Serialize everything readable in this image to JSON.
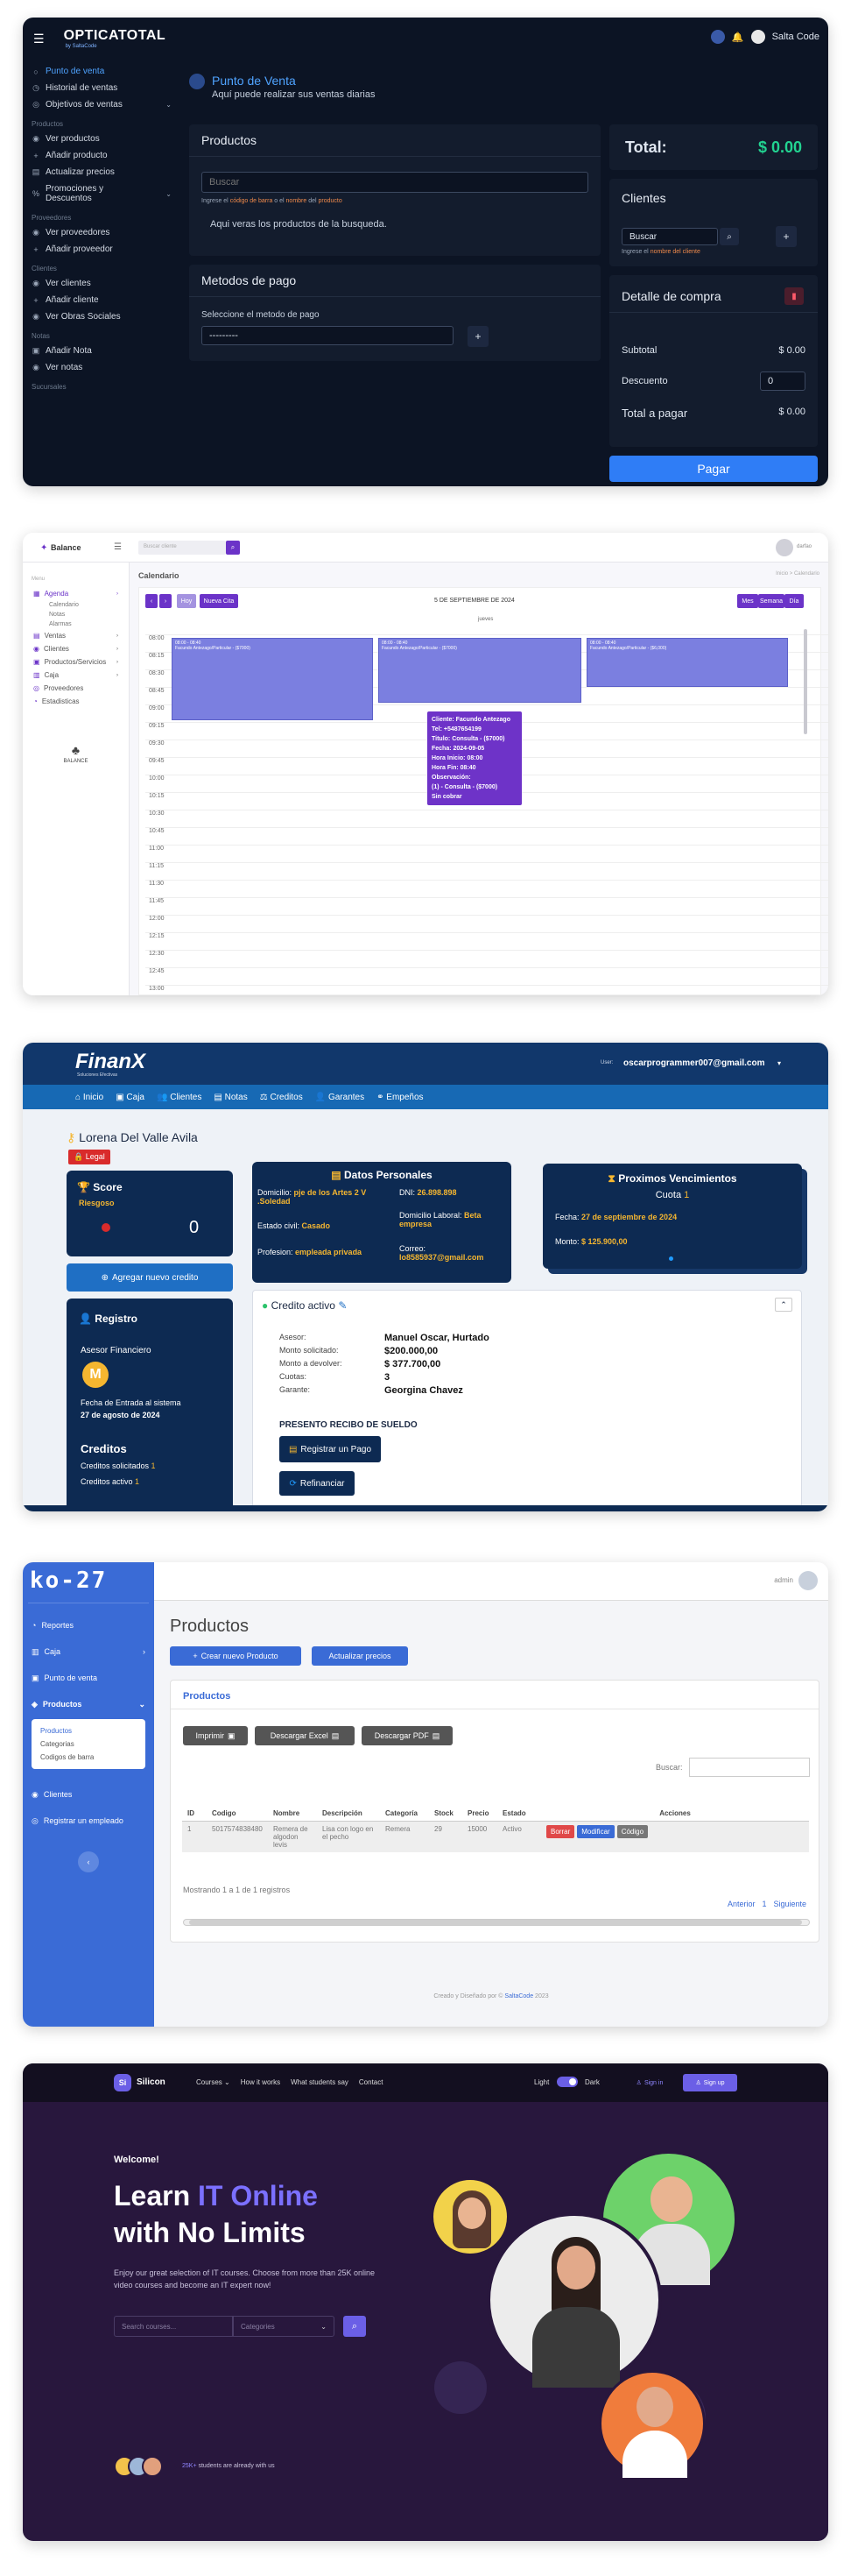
{
  "p1": {
    "brand": "OPTICATOTAL",
    "brand_sub": "by SaltaCode",
    "user": "Salta Code",
    "title": "Punto de Venta",
    "subtitle": "Aquí puede realizar sus ventas diarias",
    "sidebar": [
      {
        "type": "item",
        "label": "Punto de venta",
        "active": true,
        "icon": "○"
      },
      {
        "type": "item",
        "label": "Historial de ventas",
        "icon": "◷"
      },
      {
        "type": "item",
        "label": "Objetivos de ventas",
        "icon": "◎",
        "chev": true
      },
      {
        "type": "sec",
        "label": "Productos"
      },
      {
        "type": "item",
        "label": "Ver productos",
        "icon": "◉"
      },
      {
        "type": "item",
        "label": "Añadir producto",
        "icon": "+"
      },
      {
        "type": "item",
        "label": "Actualizar precios",
        "icon": "▤"
      },
      {
        "type": "item",
        "label": "Promociones y Descuentos",
        "icon": "%",
        "chev": true,
        "tall": true
      },
      {
        "type": "sec",
        "label": "Proveedores"
      },
      {
        "type": "item",
        "label": "Ver proveedores",
        "icon": "◉"
      },
      {
        "type": "item",
        "label": "Añadir proveedor",
        "icon": "+"
      },
      {
        "type": "sec",
        "label": "Clientes"
      },
      {
        "type": "item",
        "label": "Ver clientes",
        "icon": "◉"
      },
      {
        "type": "item",
        "label": "Añadir cliente",
        "icon": "+"
      },
      {
        "type": "item",
        "label": "Ver Obras Sociales",
        "icon": "◉"
      },
      {
        "type": "sec",
        "label": "Notas"
      },
      {
        "type": "item",
        "label": "Añadir Nota",
        "icon": "▣"
      },
      {
        "type": "item",
        "label": "Ver notas",
        "icon": "◉"
      },
      {
        "type": "sec",
        "label": "Sucursales"
      }
    ],
    "productos_title": "Productos",
    "search_placeholder": "Buscar",
    "search_hint_a": "Ingrese el ",
    "search_hint_b": "código de barra",
    "search_hint_c": " o el ",
    "search_hint_d": "nombre",
    "search_hint_e": " del ",
    "search_hint_f": "producto",
    "empty_text": "Aqui veras los productos de la busqueda.",
    "metodos_title": "Metodos de pago",
    "metodos_label": "Seleccione el metodo de pago",
    "metodos_value": "---------",
    "total_label": "Total:",
    "total_value": "$ 0.00",
    "clientes_title": "Clientes",
    "clientes_value": "Buscar",
    "clientes_hint_a": "Ingrese el ",
    "clientes_hint_b": "nombre del cliente",
    "detalle_title": "Detalle de compra",
    "subtotal_label": "Subtotal",
    "subtotal_value": "$ 0.00",
    "descuento_label": "Descuento",
    "descuento_value": "0",
    "pagar_label": "Total a pagar",
    "pagar_value": "$ 0.00",
    "pagar_button": "Pagar"
  },
  "p2": {
    "brand": "Balance",
    "search_placeholder": "Buscar cliente",
    "user": "darfao",
    "menu_label": "Menu",
    "sidebar": [
      {
        "label": "Agenda",
        "icon": "▦",
        "chev": true,
        "active": true
      },
      {
        "label": "Calendario",
        "sub": true
      },
      {
        "label": "Notas",
        "sub": true
      },
      {
        "label": "Alarmas",
        "sub": true
      },
      {
        "label": "Ventas",
        "icon": "▤",
        "chev": true
      },
      {
        "label": "Clientes",
        "icon": "◉",
        "chev": true
      },
      {
        "label": "Productos/Servicios",
        "icon": "▣",
        "chev": true
      },
      {
        "label": "Caja",
        "icon": "▥",
        "chev": true
      },
      {
        "label": "Proveedores",
        "icon": "◎"
      },
      {
        "label": "Estadisticas",
        "icon": "◔"
      }
    ],
    "logo_text": "BALANCE",
    "page_title": "Calendario",
    "breadcrumb": "Inicio  >  Calendario",
    "btn_hoy": "Hoy",
    "btn_nueva": "Nueva Cita",
    "date_title": "5 DE SEPTIEMBRE DE 2024",
    "btn_mes": "Mes",
    "btn_semana": "Semana",
    "btn_dia": "Día",
    "day_header": "jueves",
    "times": [
      "08:00",
      "08:15",
      "08:30",
      "08:45",
      "09:00",
      "09:15",
      "09:30",
      "09:45",
      "10:00",
      "10:15",
      "10:30",
      "10:45",
      "11:00",
      "11:15",
      "11:30",
      "11:45",
      "12:00",
      "12:15",
      "12:30",
      "12:45",
      "13:00"
    ],
    "ev_time": "08:00 - 08:40",
    "ev_text1": "Facundo Antezago/Particular - ($7000)",
    "ev_text2": "Facundo Antezago/Particular - ($7000)",
    "ev_text3": "Facundo Antezago/Particular - ($6,000)",
    "tooltip": [
      "Cliente: Facundo Antezago",
      "Tel: +5487654199",
      "Titulo: Consulta - ($7000)",
      "Fecha: 2024-09-05",
      "Hora Inicio: 08:00",
      "Hora Fin: 08:40",
      "Observación:",
      "(1) - Consulta - ($7000)",
      "Sin cobrar"
    ]
  },
  "p3": {
    "brand": "FinanX",
    "brand_sub": "Soluciones Efectivas",
    "user_label": "User:",
    "user_email": "oscarprogrammer007@gmail.com",
    "nav": [
      "Inicio",
      "Caja",
      "Clientes",
      "Notas",
      "Creditos",
      "Garantes",
      "Empeños"
    ],
    "client_name": "Lorena Del Valle Avila",
    "legal_badge": "Legal",
    "score_title": "Score",
    "score_sub": "Riesgoso",
    "score_value": "0",
    "nuevo_credito": "Agregar nuevo credito",
    "registro_title": "Registro",
    "asesor_label": "Asesor Financiero",
    "fecha_entrada_label": "Fecha de Entrada al sistema",
    "fecha_entrada": "27 de agosto de 2024",
    "creditos_title": "Creditos",
    "creditos_solicitados_label": "Creditos solicitados ",
    "creditos_solicitados": "1",
    "creditos_activo_label": "Creditos activo ",
    "creditos_activo": "1",
    "datos_title": "Datos Personales",
    "domicilio_label": "Domicilio: ",
    "domicilio": "pje de los Artes 2  V .Soledad",
    "dni_label": "DNI: ",
    "dni": "26.898.898",
    "estado_label": "Estado civil: ",
    "estado": "Casado",
    "laboral_label": "Domicilio Laboral: ",
    "laboral": "Beta empresa",
    "profesion_label": "Profesion: ",
    "profesion": "empleada privada",
    "correo_label": "Correo:",
    "correo": "lo8585937@gmail.com",
    "venc_title": "Proximos Vencimientos",
    "cuota_label": "Cuota ",
    "cuota": "1",
    "fecha_label": "Fecha: ",
    "fecha": "27 de septiembre de 2024",
    "monto_label": "Monto: ",
    "monto": "$ 125.900,00",
    "credito_activo": "Credito activo",
    "asesor_k": "Asesor:",
    "asesor_v": "Manuel Oscar, Hurtado",
    "solicitado_k": "Monto solicitado:",
    "solicitado_v": "$200.000,00",
    "devolver_k": "Monto a devolver:",
    "devolver_v": "$ 377.700,00",
    "cuotas_k": "Cuotas:",
    "cuotas_v": "3",
    "garante_k": "Garante:",
    "garante_v": "Georgina Chavez",
    "recibo": "PRESENTO RECIBO DE SUELDO",
    "registrar_pago": "Registrar un Pago",
    "refinanciar": "Refinanciar"
  },
  "p4": {
    "brand": "ko-27",
    "user": "admin",
    "sidebar": [
      "Reportes",
      "Caja",
      "Punto de venta",
      "Productos",
      "Clientes",
      "Registrar un empleado"
    ],
    "sub": [
      "Productos",
      "Categorias",
      "Codigos de barra"
    ],
    "page_title": "Productos",
    "crear": "Crear nuevo Producto",
    "actualizar": "Actualizar precios",
    "card_title": "Productos",
    "imprimir": "Imprimir",
    "excel": "Descargar Excel",
    "pdf": "Descargar PDF",
    "buscar_label": "Buscar:",
    "columns": [
      "ID",
      "Codigo",
      "Nombre",
      "Descripción",
      "Categoría",
      "Stock",
      "Precio",
      "Estado",
      "Acciones"
    ],
    "row": [
      "1",
      "5017574838480",
      "Remera de algodon levis",
      "Lisa con logo en el pecho",
      "Remera",
      "29",
      "15000",
      "Activo"
    ],
    "borrar": "Borrar",
    "modificar": "Modificar",
    "codigo": "Código",
    "mostrando": "Mostrando 1 a 1 de 1 registros",
    "anterior": "Anterior",
    "pagina": "1",
    "siguiente": "Siguiente",
    "footer_a": "Creado y Diseñado por © ",
    "footer_b": "SaltaCode",
    "footer_c": " 2023"
  },
  "p5": {
    "brand": "Silicon",
    "nav": [
      "Courses",
      "How it works",
      "What students say",
      "Contact"
    ],
    "light": "Light",
    "dark": "Dark",
    "signin": "Sign in",
    "signup": "Sign up",
    "welcome": "Welcome!",
    "h1_a": "Learn ",
    "h1_b": "IT Online",
    "h1_c": "with No Limits",
    "desc": "Enjoy our great selection of IT courses. Choose from more than 25K online video courses and become an IT expert now!",
    "search_placeholder": "Search courses...",
    "categories": "Categories",
    "students_count": "25K+",
    "students_text": " students are already with us"
  }
}
